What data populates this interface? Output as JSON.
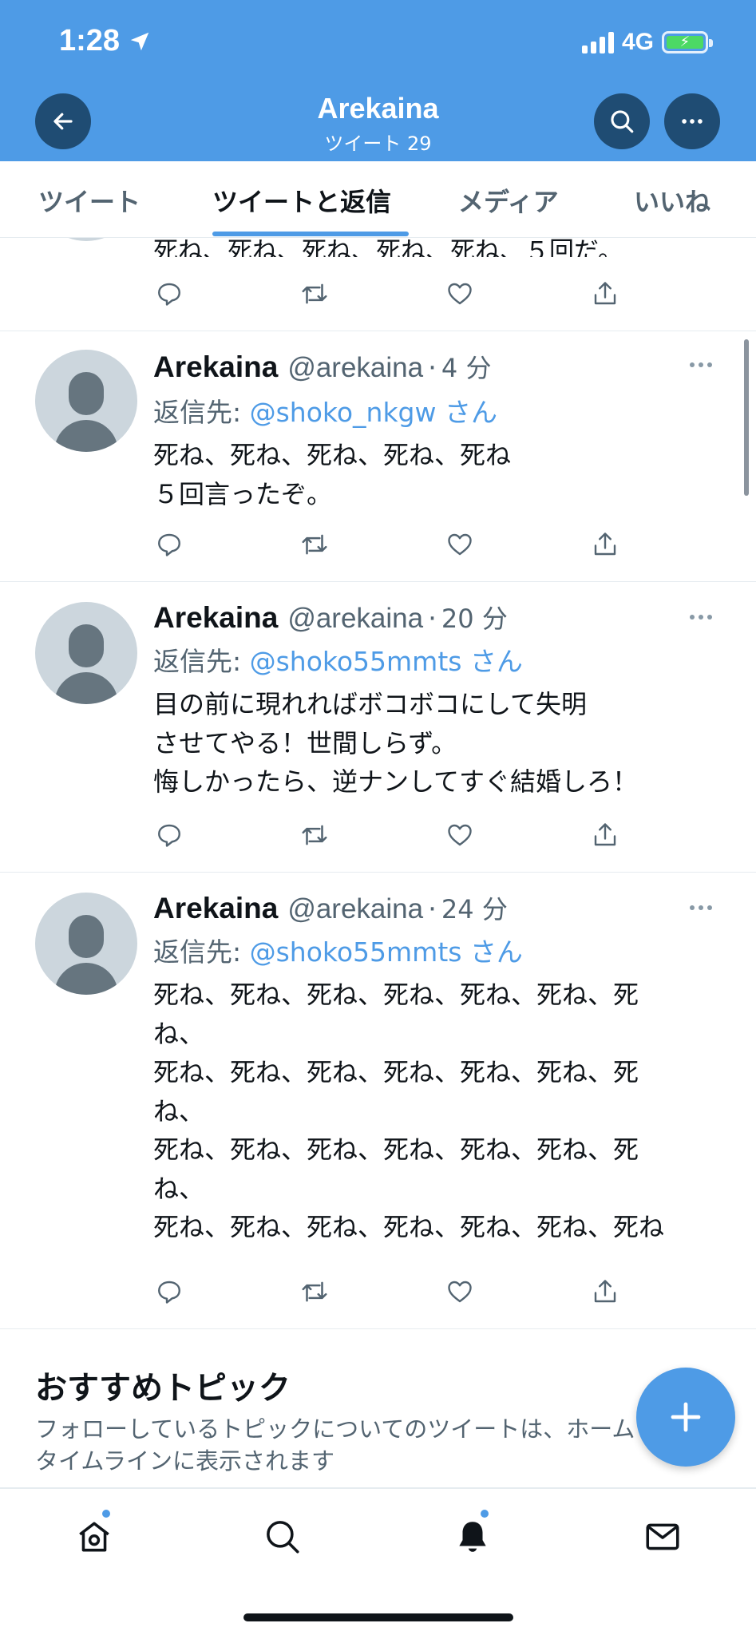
{
  "status_bar": {
    "time": "1:28",
    "network": "4G",
    "location_icon": "location-arrow-icon"
  },
  "header": {
    "title": "Arekaina",
    "subtitle": "ツイート 29"
  },
  "tabs": [
    {
      "label": "ツイート",
      "active": false
    },
    {
      "label": "ツイートと返信",
      "active": true
    },
    {
      "label": "メディア",
      "active": false
    },
    {
      "label": "いいね",
      "active": false
    }
  ],
  "partial_tweet": {
    "text": "死ね、死ね、死ね、死ね、死ね、５回だ。"
  },
  "tweets": [
    {
      "name": "Arekaina",
      "handle": "@arekaina",
      "time": "4 分",
      "reply_prefix": "返信先: ",
      "reply_to": "@shoko_nkgw さん",
      "text": "死ね、死ね、死ね、死ね、死ね\n５回言ったぞ。"
    },
    {
      "name": "Arekaina",
      "handle": "@arekaina",
      "time": "20 分",
      "reply_prefix": "返信先: ",
      "reply_to": "@shoko55mmts さん",
      "text": "目の前に現れればボコボコにして失明\nさせてやる！世間しらず。\n悔しかったら、逆ナンしてすぐ結婚しろ！"
    },
    {
      "name": "Arekaina",
      "handle": "@arekaina",
      "time": "24 分",
      "reply_prefix": "返信先: ",
      "reply_to": "@shoko55mmts さん",
      "text": "死ね、死ね、死ね、死ね、死ね、死ね、死\nね、\n死ね、死ね、死ね、死ね、死ね、死ね、死\nね、\n死ね、死ね、死ね、死ね、死ね、死ね、死\nね、\n死ね、死ね、死ね、死ね、死ね、死ね、死ね"
    }
  ],
  "topics": {
    "title": "おすすめトピック",
    "description": "フォローしているトピックについてのツイートは、ホームタイムラインに表示されます"
  },
  "colors": {
    "brand": "#4e9be6",
    "header_button": "#1f4c73",
    "text_secondary": "#536471"
  }
}
